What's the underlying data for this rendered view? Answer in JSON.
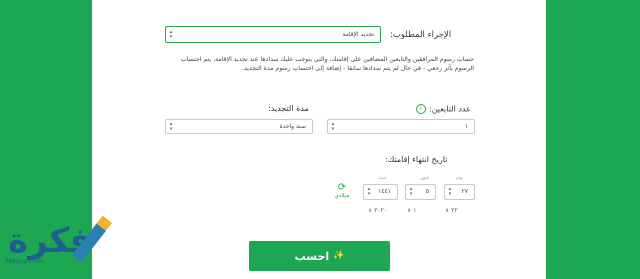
{
  "procedure": {
    "label": "الإجراء المطلوب:",
    "selected": "تجديد الإقامة"
  },
  "description": "حساب رسوم المرافقين والتابعين المضافين على إقامتك، والتي يتوجب عليك سدادها عند تجديد الإقامة، يتم احتساب الرسوم بأثر رجعي - في حال لم يتم سدادها سابقا - إضافة إلى احتساب رسوم مدة التجديد.",
  "dependents": {
    "label": "عدد التابعين:",
    "value": "١"
  },
  "duration": {
    "label": "مدة التجديد:",
    "value": "سنة واحدة"
  },
  "expiry": {
    "label": "تاريخ انتهاء إقامتك:",
    "headers": {
      "day": "يوم",
      "month": "شهر",
      "year": "سنة"
    },
    "hijri": {
      "day": "٢٧",
      "month": "٥",
      "year": "١٤٤١"
    },
    "gregorian": {
      "day": "٢٢",
      "month": "١",
      "year": "٢٠٢٠"
    },
    "toggle": "ميلادي"
  },
  "calculate_label": "احسب",
  "logo": {
    "text": "فكرة",
    "domain": "fekera.com"
  },
  "colors": {
    "brand_green": "#1ea752",
    "panel": "#ffffff"
  }
}
